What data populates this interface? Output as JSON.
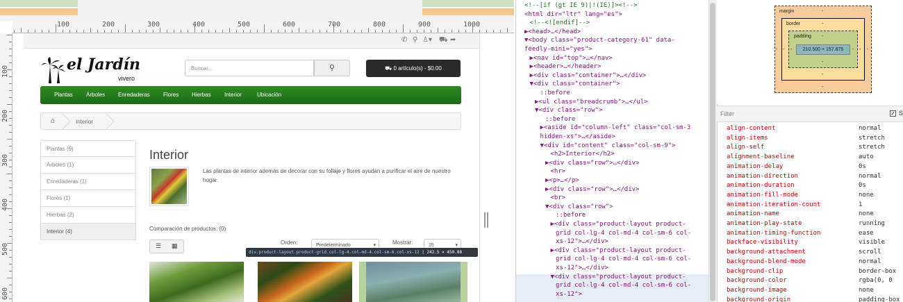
{
  "ruler": {
    "h_labels": [
      "100",
      "200",
      "300",
      "400",
      "500",
      "600",
      "700",
      "800",
      "900",
      "1000"
    ],
    "v_labels": [
      "100",
      "200",
      "300",
      "400",
      "500",
      "600"
    ]
  },
  "site": {
    "topbar_icons": [
      "phone-icon",
      "map-marker-icon",
      "user-icon",
      "cart-icon",
      "share-icon"
    ],
    "logo_text": "el Jardín",
    "logo_sub": "vivero",
    "search_placeholder": "Buscar...",
    "cart": "0 artículo(s) - $0.00",
    "menu": [
      "Plantas",
      "Árboles",
      "Enredaderas",
      "Flores",
      "Hierbas",
      "Interior",
      "Ubicación"
    ],
    "breadcrumb": "Interior",
    "categories": [
      "Plantas (9)",
      "Árboles (1)",
      "Enredaderas (1)",
      "Flores (1)",
      "Hierbas (2)",
      "Interior (4)"
    ],
    "active_category": 5,
    "heading": "Interior",
    "description": "Las plantas de interior además de decorar con su follaje y flores ayudan a purificar el aire de nuestro hogar.",
    "compare": "Comparación de productos: (0)",
    "order_label": "Orden:",
    "order_value": "Predeterminado",
    "show_label": "Mostrar:",
    "show_value": "15",
    "tooltip_class": "div.product-layout.product-grid.col-lg-4.col-md-4.col-sm-6.col-xs-12",
    "tooltip_size": "242.5 × 450.88"
  },
  "dom_lines": [
    {
      "t": "<!--[if (gt IE 9)|!(IE)]><!-->",
      "k": "cm",
      "i": 0
    },
    {
      "t": "<html dir=\"ltr\" lang=\"es\">",
      "k": "tg",
      "i": 0
    },
    {
      "t": "<!--<![endif]-->",
      "k": "cm",
      "i": 1
    },
    {
      "t": "▶<head>…</head>",
      "k": "tg",
      "i": 0
    },
    {
      "t": "▼<body class=\"product-category-61\" data-",
      "k": "tg",
      "i": 0
    },
    {
      "t": "feedly-mini=\"yes\">",
      "k": "tg",
      "i": 0
    },
    {
      "t": "▶<nav id=\"top\">…</nav>",
      "k": "tg",
      "i": 1
    },
    {
      "t": "▶<header>…</header>",
      "k": "tg",
      "i": 1
    },
    {
      "t": "▶<div class=\"container\">…</div>",
      "k": "tg",
      "i": 1
    },
    {
      "t": "▼<div class=\"container\">",
      "k": "tg",
      "i": 1
    },
    {
      "t": "::before",
      "k": "ps",
      "i": 3
    },
    {
      "t": "▶<ul class=\"breadcrumb\">…</ul>",
      "k": "tg",
      "i": 2
    },
    {
      "t": "▼<div class=\"row\">",
      "k": "tg",
      "i": 2
    },
    {
      "t": "::before",
      "k": "ps",
      "i": 4
    },
    {
      "t": "▶<aside id=\"column-left\" class=\"col-sm-3",
      "k": "tg",
      "i": 3
    },
    {
      "t": "hidden-xs\">…</aside>",
      "k": "tg",
      "i": 3
    },
    {
      "t": "▼<div id=\"content\" class=\"col-sm-9\">",
      "k": "tg",
      "i": 3
    },
    {
      "t": "<h2>Interior</h2>",
      "k": "tg",
      "i": 5
    },
    {
      "t": "▶<div class=\"row\">…</div>",
      "k": "tg",
      "i": 4
    },
    {
      "t": "<hr>",
      "k": "tg",
      "i": 5
    },
    {
      "t": "▶<p>…</p>",
      "k": "tg",
      "i": 4
    },
    {
      "t": "▶<div class=\"row\">…</div>",
      "k": "tg",
      "i": 4
    },
    {
      "t": "<br>",
      "k": "tg",
      "i": 5
    },
    {
      "t": "▼<div class=\"row\">",
      "k": "tg",
      "i": 4
    },
    {
      "t": "::before",
      "k": "ps",
      "i": 6
    },
    {
      "t": "▶<div class=\"product-layout product-",
      "k": "tg",
      "i": 5
    },
    {
      "t": "grid col-lg-4 col-md-4 col-sm-6 col-",
      "k": "tg",
      "i": 6
    },
    {
      "t": "xs-12\">…</div>",
      "k": "tg",
      "i": 6
    },
    {
      "t": "▶<div class=\"product-layout product-",
      "k": "tg",
      "i": 5
    },
    {
      "t": "grid col-lg-4 col-md-4 col-sm-6 col-",
      "k": "tg",
      "i": 6
    },
    {
      "t": "xs-12\">…</div>",
      "k": "tg",
      "i": 6
    },
    {
      "t": "▼<div class=\"product-layout product-",
      "k": "tg",
      "i": 5
    },
    {
      "t": "grid col-lg-4 col-md-4 col-sm-6 col-",
      "k": "tg",
      "i": 6
    },
    {
      "t": "xs-12\">",
      "k": "tg",
      "i": 6
    }
  ],
  "boxmodel": {
    "margin": "margin",
    "border": "border",
    "padding": "padding",
    "dash": "-",
    "content": "210.500 × 157.875"
  },
  "styles": {
    "filter": "Filter",
    "show_all": "S",
    "props": [
      [
        "align-content",
        "normal"
      ],
      [
        "align-items",
        "stretch"
      ],
      [
        "align-self",
        "stretch"
      ],
      [
        "alignment-baseline",
        "auto"
      ],
      [
        "animation-delay",
        "0s"
      ],
      [
        "animation-direction",
        "normal"
      ],
      [
        "animation-duration",
        "0s"
      ],
      [
        "animation-fill-mode",
        "none"
      ],
      [
        "animation-iteration-count",
        "1"
      ],
      [
        "animation-name",
        "none"
      ],
      [
        "animation-play-state",
        "running"
      ],
      [
        "animation-timing-function",
        "ease"
      ],
      [
        "backface-visibility",
        "visible"
      ],
      [
        "background-attachment",
        "scroll"
      ],
      [
        "background-blend-mode",
        "normal"
      ],
      [
        "background-clip",
        "border-box"
      ],
      [
        "background-color",
        "rgba(0, 0"
      ],
      [
        "background-image",
        "none"
      ],
      [
        "background-origin",
        "padding-box"
      ]
    ]
  },
  "colors": {
    "menu_green": "#2a7d1e",
    "prop_name": "#c80000",
    "margin_box": "#f9cc9d",
    "border_box": "#fddd9b",
    "padding_box": "#c3d08b",
    "content_box": "#8cb6c0"
  }
}
